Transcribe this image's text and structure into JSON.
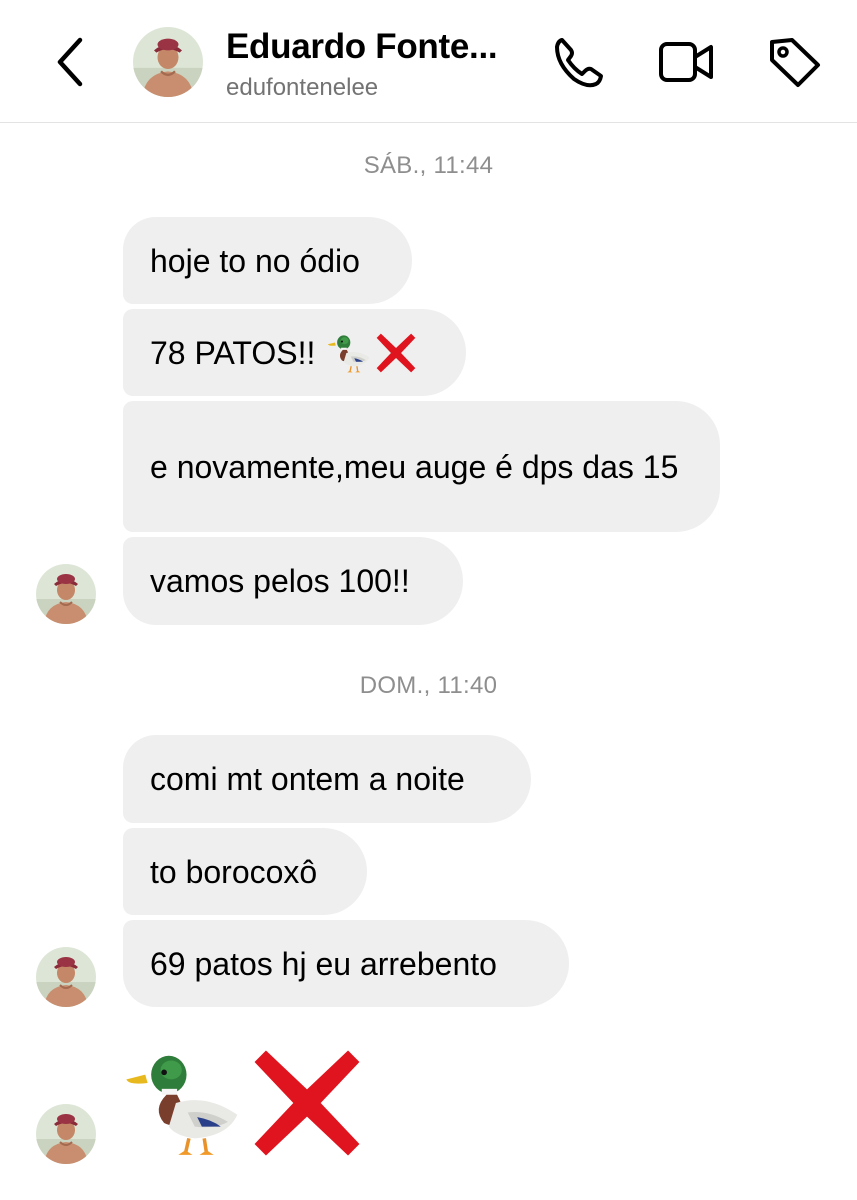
{
  "header": {
    "name": "Eduardo Fonte...",
    "handle": "edufontenelee",
    "back_icon": "chevron-left-icon",
    "actions": [
      "phone-icon",
      "video-camera-icon",
      "tag-icon"
    ]
  },
  "conversation": {
    "day1": {
      "timestamp": "SÁB., 11:44",
      "messages": [
        {
          "text": "hoje to no ódio"
        },
        {
          "text": "78 PATOS!!",
          "emojis": [
            "duck-emoji",
            "cross-mark-emoji"
          ]
        },
        {
          "text": "e novamente,meu auge é dps das 15"
        },
        {
          "text": "vamos pelos 100!!"
        }
      ]
    },
    "day2": {
      "timestamp": "DOM., 11:40",
      "messages": [
        {
          "text": "comi mt ontem a noite"
        },
        {
          "text": "to borocoxô"
        },
        {
          "text": "69 patos hj eu arrebento"
        },
        {
          "emojis": [
            "duck-emoji",
            "cross-mark-emoji"
          ]
        }
      ]
    }
  },
  "colors": {
    "bubble": "#efefef",
    "timestamp": "#8e8e8e",
    "handle": "#737373",
    "cross": "#e0141e"
  }
}
